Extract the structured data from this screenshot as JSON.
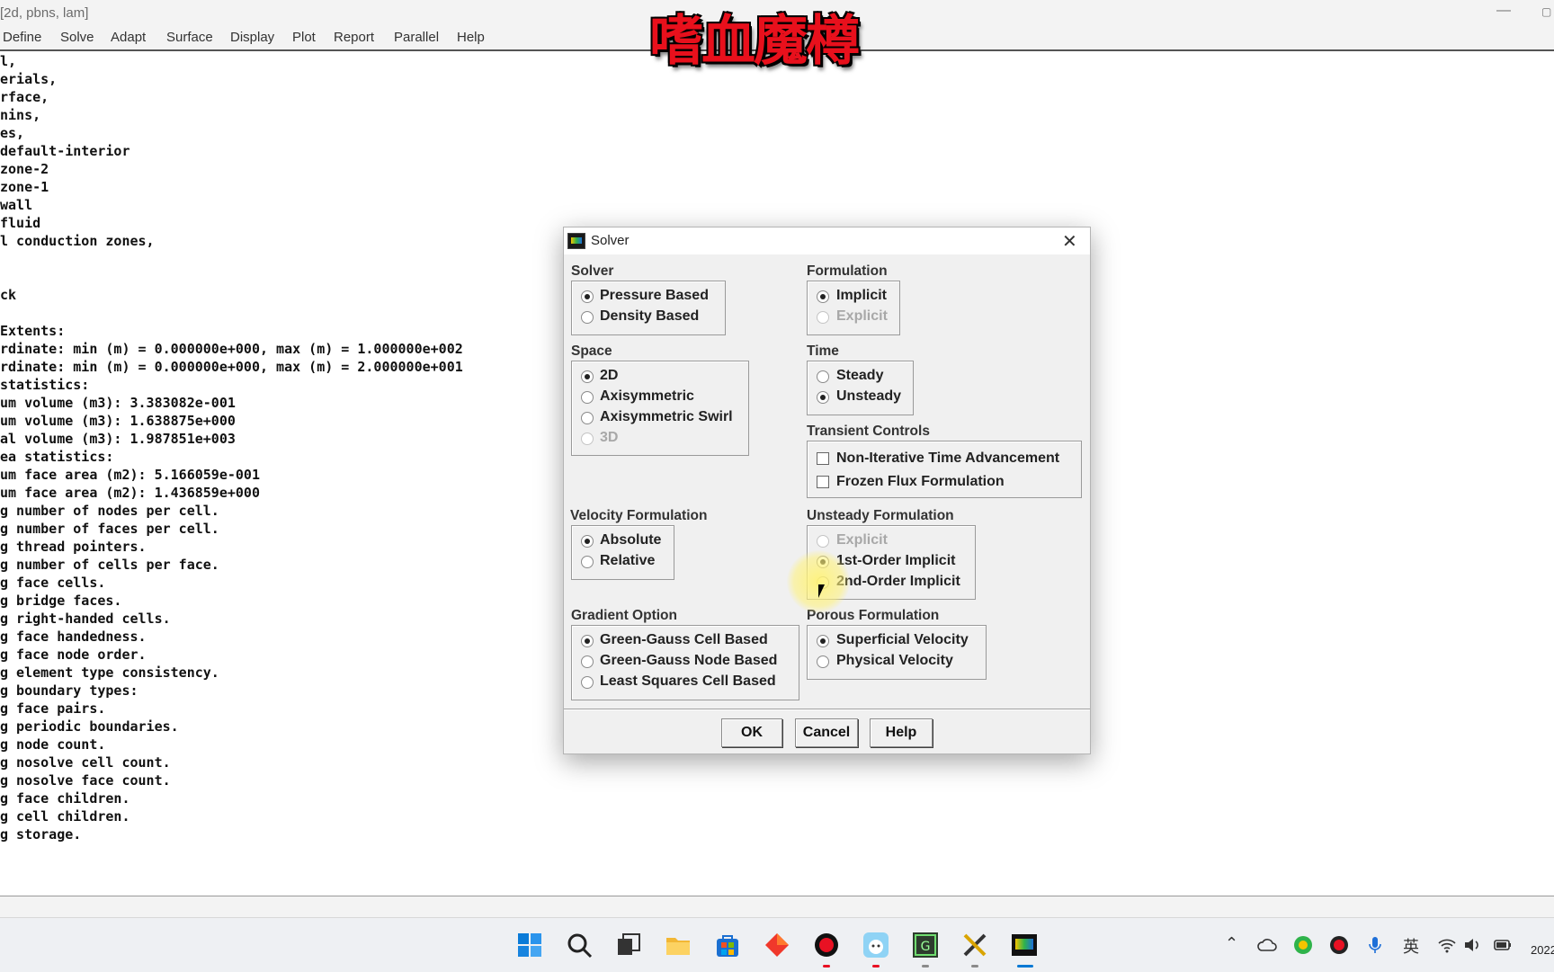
{
  "window": {
    "title": "[2d, pbns, lam]"
  },
  "menu": [
    "Define",
    "Solve",
    "Adapt",
    "Surface",
    "Display",
    "Plot",
    "Report",
    "Parallel",
    "Help"
  ],
  "watermark": "嗜血魔樽",
  "console_lines": [
    "l,",
    "erials,",
    "rface,",
    "nins,",
    "es,",
    "default-interior",
    "zone-2",
    "zone-1",
    "wall",
    "fluid",
    "l conduction zones,",
    "",
    "",
    "ck",
    "",
    "Extents:",
    "rdinate: min (m) = 0.000000e+000, max (m) = 1.000000e+002",
    "rdinate: min (m) = 0.000000e+000, max (m) = 2.000000e+001",
    "statistics:",
    "um volume (m3): 3.383082e-001",
    "um volume (m3): 1.638875e+000",
    "al volume (m3): 1.987851e+003",
    "ea statistics:",
    "um face area (m2): 5.166059e-001",
    "um face area (m2): 1.436859e+000",
    "g number of nodes per cell.",
    "g number of faces per cell.",
    "g thread pointers.",
    "g number of cells per face.",
    "g face cells.",
    "g bridge faces.",
    "g right-handed cells.",
    "g face handedness.",
    "g face node order.",
    "g element type consistency.",
    "g boundary types:",
    "g face pairs.",
    "g periodic boundaries.",
    "g node count.",
    "g nosolve cell count.",
    "g nosolve face count.",
    "g face children.",
    "g cell children.",
    "g storage."
  ],
  "dialog": {
    "title": "Solver",
    "solver": {
      "label": "Solver",
      "options": [
        "Pressure Based",
        "Density Based"
      ]
    },
    "formulation": {
      "label": "Formulation",
      "options": [
        "Implicit",
        "Explicit"
      ]
    },
    "space": {
      "label": "Space",
      "options": [
        "2D",
        "Axisymmetric",
        "Axisymmetric Swirl",
        "3D"
      ]
    },
    "time": {
      "label": "Time",
      "options": [
        "Steady",
        "Unsteady"
      ]
    },
    "transient": {
      "label": "Transient Controls",
      "options": [
        "Non-Iterative Time Advancement",
        "Frozen Flux Formulation"
      ]
    },
    "velocity": {
      "label": "Velocity Formulation",
      "options": [
        "Absolute",
        "Relative"
      ]
    },
    "unsteady": {
      "label": "Unsteady Formulation",
      "options": [
        "Explicit",
        "1st-Order Implicit",
        "2nd-Order Implicit"
      ]
    },
    "gradient": {
      "label": "Gradient Option",
      "options": [
        "Green-Gauss Cell Based",
        "Green-Gauss Node Based",
        "Least Squares Cell Based"
      ]
    },
    "porous": {
      "label": "Porous Formulation",
      "options": [
        "Superficial Velocity",
        "Physical Velocity"
      ]
    },
    "buttons": {
      "ok": "OK",
      "cancel": "Cancel",
      "help": "Help"
    }
  },
  "taskbar": {
    "clock": "2022",
    "ime": "英"
  },
  "colors": {
    "watermark": "#e8101c",
    "accent": "#0078d4"
  }
}
